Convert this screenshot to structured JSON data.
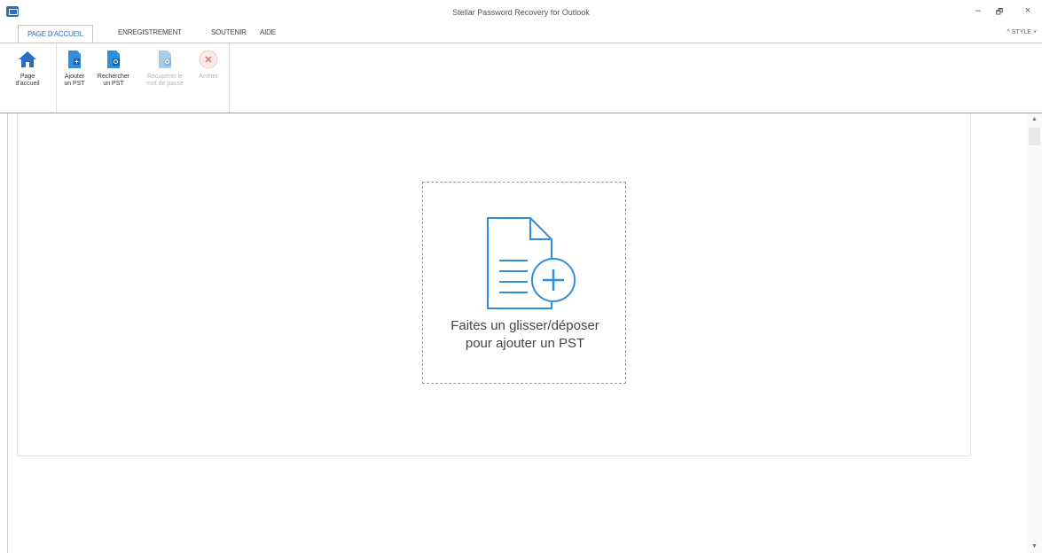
{
  "window": {
    "title": "Stellar Password Recovery for Outlook",
    "minimize": "–",
    "restore": "🗗",
    "close": "×"
  },
  "tabs": [
    {
      "label": "PAGE D'ACCUEIL"
    },
    {
      "label": "ENREGISTREMENT"
    },
    {
      "label": "SOUTENIR"
    },
    {
      "label": "AIDE"
    }
  ],
  "style_menu": "^ STYLE ˅",
  "ribbon": {
    "home": {
      "line1": "Page",
      "line2": "d'accueil"
    },
    "add_pst": {
      "line1": "Ajouter",
      "line2": "un PST"
    },
    "search_pst": {
      "line1": "Rechercher",
      "line2": "un PST"
    },
    "recover": {
      "line1": "Récupérer le",
      "line2": "mot de passe"
    },
    "stop": {
      "line1": "Arrêter",
      "line2": ""
    }
  },
  "dropzone": {
    "line1": "Faites un glisser/déposer",
    "line2": "pour ajouter un PST"
  },
  "scrollbar": {
    "up": "▲",
    "down": "▼"
  },
  "colors": {
    "accent": "#2b6cc4",
    "icon_blue": "#2f8fdc"
  }
}
